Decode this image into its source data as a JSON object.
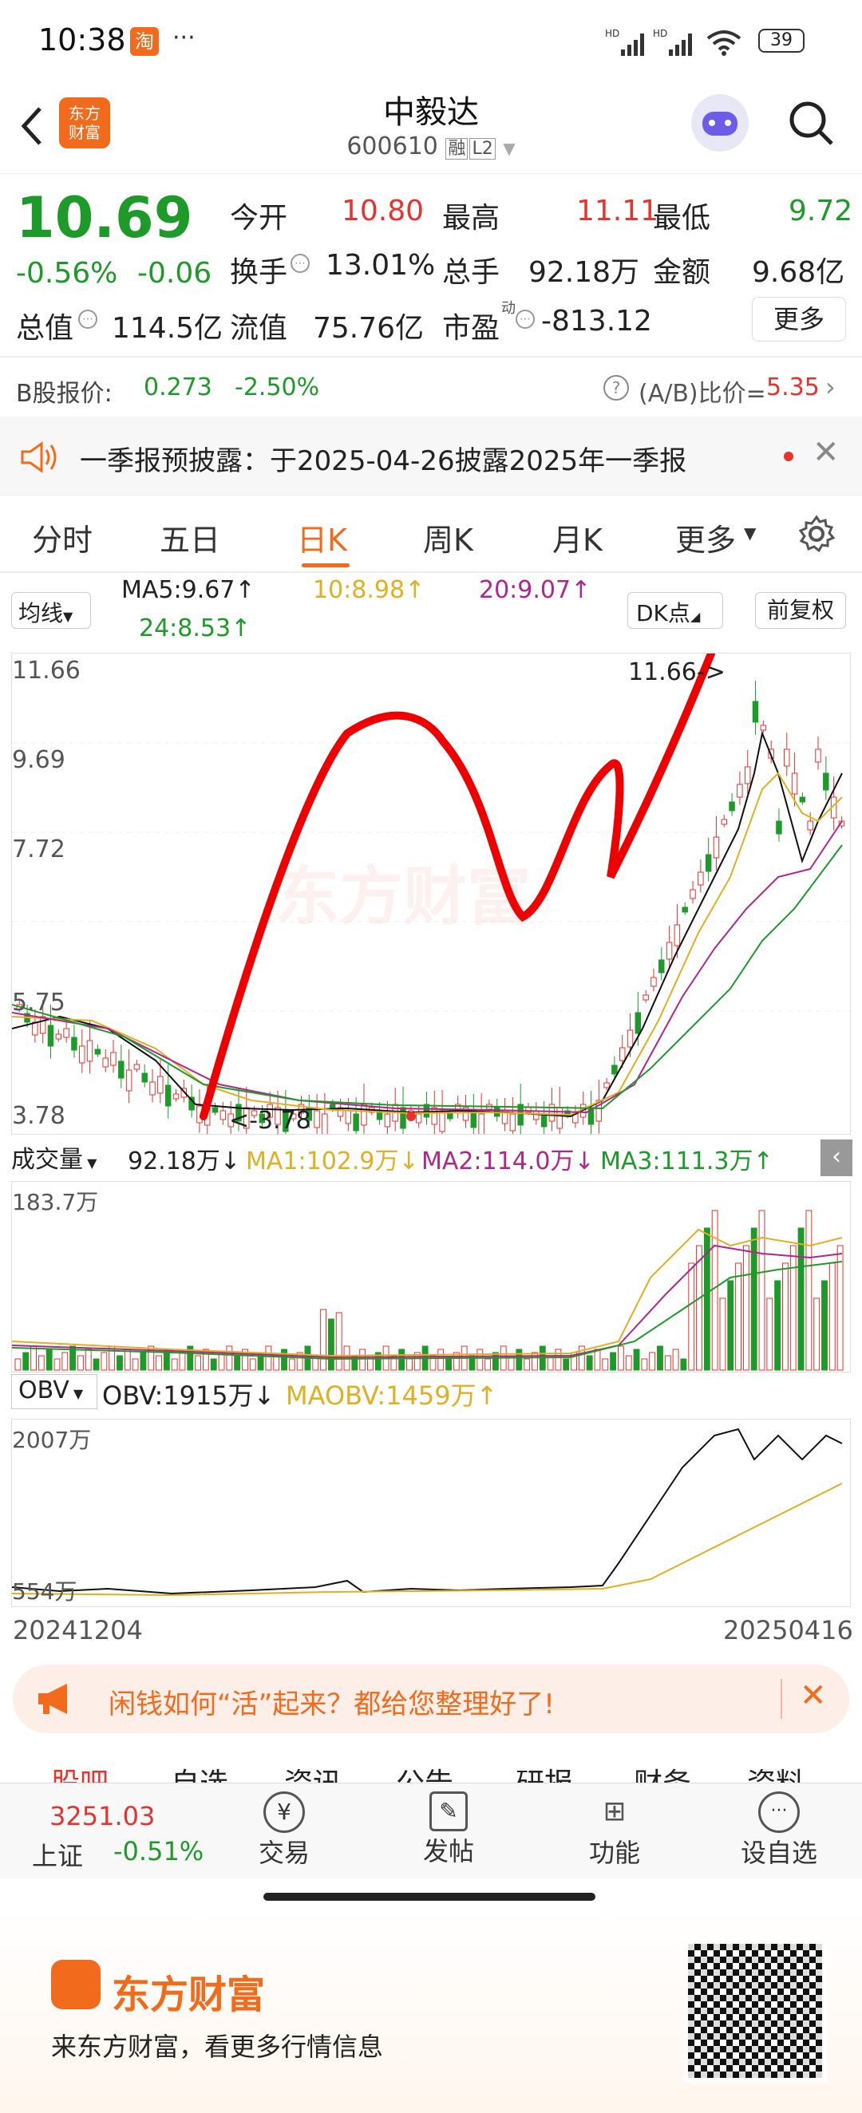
{
  "status": {
    "time": "10:38",
    "app_badge": "淘",
    "dots": "···",
    "battery": "39"
  },
  "nav": {
    "logo_text": "东方\n财富",
    "title": "中毅达",
    "code": "600610",
    "tag1": "融",
    "tag2": "L2"
  },
  "quote": {
    "price": "10.69",
    "change_pct": "-0.56%",
    "change": "-0.06",
    "open_label": "今开",
    "open": "10.80",
    "high_label": "最高",
    "high": "11.11",
    "low_label": "最低",
    "low": "9.72",
    "turnover_label": "换手",
    "turnover": "13.01%",
    "volume_label": "总手",
    "volume": "92.18万",
    "amount_label": "金额",
    "amount": "9.68亿",
    "mktcap_label": "总值",
    "mktcap": "114.5亿",
    "float_label": "流值",
    "float": "75.76亿",
    "pe_label": "市盈",
    "pe_sup": "动",
    "pe": "-813.12",
    "more_button": "更多"
  },
  "b_share": {
    "label": "B股报价:",
    "price": "0.273",
    "pct": "-2.50%",
    "ratio_label": "(A/B)比价=",
    "ratio": "5.35"
  },
  "notice": {
    "text": "一季报预披露：于2025-04-26披露2025年一季报"
  },
  "tabs": [
    "分时",
    "五日",
    "日K",
    "周K",
    "月K",
    "更多"
  ],
  "active_tab": "日K",
  "ma_bar": {
    "selector": "均线",
    "ma5": "MA5:9.67↑",
    "ma10": "10:8.98↑",
    "ma20": "20:9.07↑",
    "ma24": "24:8.53↑",
    "dk": "DK点",
    "adjust": "前复权"
  },
  "kline": {
    "y_labels": [
      "11.66",
      "9.69",
      "7.72",
      "5.75",
      "3.78"
    ],
    "max_label": "11.66->",
    "min_label": "<-3.78",
    "watermark": "东方财富"
  },
  "volume": {
    "selector": "成交量",
    "value": "92.18万↓",
    "ma1": "MA1:102.9万↓",
    "ma2": "MA2:114.0万↓",
    "ma3": "MA3:111.3万↑",
    "ymax": "183.7万"
  },
  "obv": {
    "selector": "OBV",
    "value": "OBV:1915万↓",
    "maobv": "MAOBV:1459万↑",
    "ymax": "2007万",
    "ymin": "554万",
    "date_start": "20241204",
    "date_end": "20250416"
  },
  "banner": {
    "text": "闲钱如何“活”起来？都给您整理好了!"
  },
  "sub_tabs": [
    "股吧",
    "自选",
    "资讯",
    "公告",
    "研报",
    "财务",
    "资料"
  ],
  "bottom_nav": {
    "index_value": "3251.03",
    "index_name": "上证",
    "index_pct": "-0.51%",
    "items": [
      "交易",
      "发帖",
      "功能",
      "设自选"
    ]
  },
  "footer": {
    "brand": "东方财富",
    "slogan": "来东方财富，看更多行情信息"
  },
  "colors": {
    "up": "#e8322d",
    "down": "#1d9a2a",
    "accent": "#f26a1b"
  }
}
